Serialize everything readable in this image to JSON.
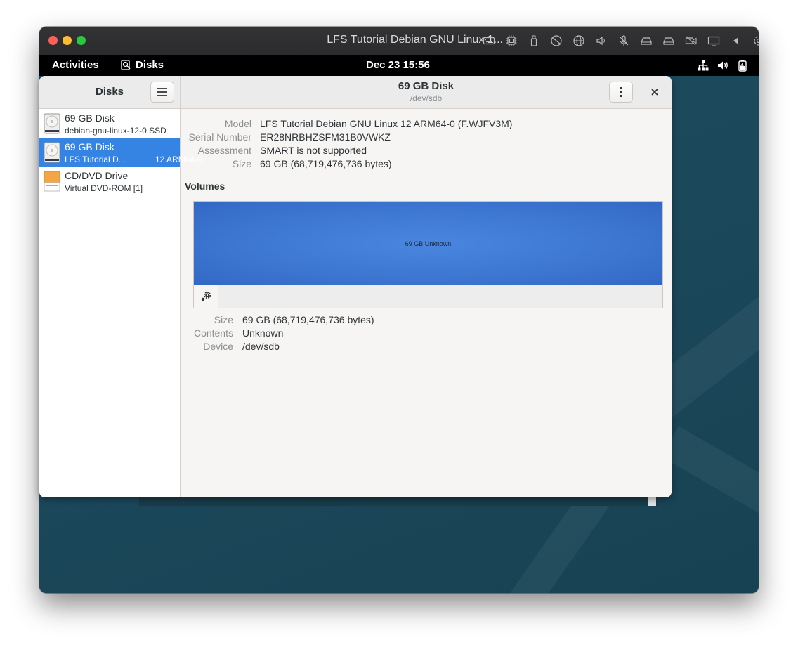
{
  "vm": {
    "title": "LFS Tutorial Debian GNU Linux 1...",
    "toolbar_icons": [
      "keyboard-icon",
      "cpu-icon",
      "usb-icon",
      "network-off-icon",
      "globe-icon",
      "speaker-icon",
      "microphone-off-icon",
      "disk-icon",
      "disk-icon",
      "camera-off-icon",
      "display-icon",
      "back-arrow-icon",
      "settings-icon"
    ]
  },
  "gnome": {
    "activities": "Activities",
    "app_name": "Disks",
    "clock": "Dec 23  15:56",
    "tray_icons": [
      "network-icon",
      "volume-icon",
      "battery-icon"
    ]
  },
  "disks_app": {
    "sidebar_title": "Disks",
    "header_title": "69 GB Disk",
    "header_subtitle": "/dev/sdb",
    "devices": [
      {
        "name": "69 GB Disk",
        "desc": "debian-gnu-linux-12-0 SSD",
        "desc2": "",
        "selected": false,
        "icon": "hard-disk-icon"
      },
      {
        "name": "69 GB Disk",
        "desc": "LFS Tutorial D...",
        "desc2": "12 ARM64-0",
        "selected": true,
        "icon": "hard-disk-icon"
      },
      {
        "name": "CD/DVD Drive",
        "desc": "Virtual DVD-ROM [1]",
        "desc2": "",
        "selected": false,
        "icon": "optical-drive-icon"
      }
    ],
    "drive_info": {
      "model_label": "Model",
      "model": "LFS Tutorial Debian GNU Linux 12 ARM64-0 (F.WJFV3M)",
      "serial_label": "Serial Number",
      "serial": "ER28NRBHZSFM31B0VWKZ",
      "assessment_label": "Assessment",
      "assessment": "SMART is not supported",
      "size_label": "Size",
      "size": "69 GB (68,719,476,736 bytes)"
    },
    "volumes_title": "Volumes",
    "partition_label": "69 GB Unknown",
    "partition_color": "#3c76d1",
    "volume_info": {
      "size_label": "Size",
      "size": "69 GB (68,719,476,736 bytes)",
      "contents_label": "Contents",
      "contents": "Unknown",
      "device_label": "Device",
      "device": "/dev/sdb"
    }
  }
}
